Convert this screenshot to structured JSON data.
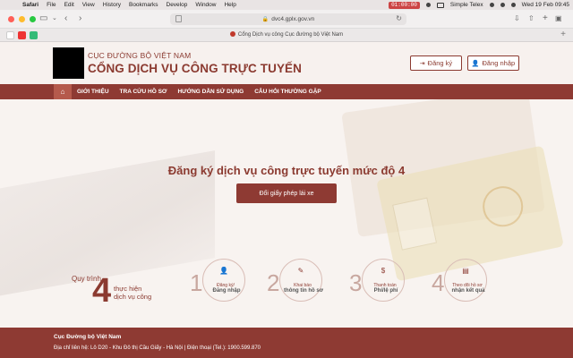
{
  "menubar": {
    "app": "Safari",
    "items": [
      "File",
      "Edit",
      "View",
      "History",
      "Bookmarks",
      "Develop",
      "Window",
      "Help"
    ],
    "timer": "01:00:00",
    "input_method": "Simple Telex",
    "datetime": "Wed 19 Feb  09:45"
  },
  "browser": {
    "url": "dvc4.gplx.gov.vn",
    "tab_title": "Cổng Dịch vụ công Cục đường bộ Việt Nam"
  },
  "header": {
    "org_name": "CỤC ĐƯỜNG BỘ VIỆT NAM",
    "portal_name": "CỔNG DỊCH VỤ CÔNG TRỰC TUYẾN",
    "register": "Đăng ký",
    "login": "Đăng nhập"
  },
  "nav": {
    "items": [
      "GIỚI THIỆU",
      "TRA CỨU HỒ SƠ",
      "HƯỚNG DẪN SỬ DỤNG",
      "CÂU HỎI THƯỜNG GẶP"
    ]
  },
  "hero": {
    "title": "Đăng ký dịch vụ công trực tuyến mức độ 4",
    "button": "Đổi giấy phép lái xe"
  },
  "process": {
    "label": "Quy trình",
    "number": "4",
    "sub1": "thực hiện",
    "sub2": "dịch vụ công",
    "steps": [
      {
        "num": "1",
        "line1": "Đăng ký/",
        "line2": "Đăng nhập",
        "icon": "user-icon"
      },
      {
        "num": "2",
        "line1": "Khai báo",
        "line2": "thông tin hồ sơ",
        "icon": "edit-icon"
      },
      {
        "num": "3",
        "line1": "Thanh toán",
        "line2": "Phí/lệ phí",
        "icon": "payment-icon"
      },
      {
        "num": "4",
        "line1": "Theo dõi hồ sơ",
        "line2": "nhận kết quả",
        "icon": "clipboard-icon"
      }
    ]
  },
  "footer": {
    "org": "Cục Đường bộ Việt Nam",
    "contact": "Địa chỉ liên hệ: Lô D20 - Khu Đô thị Cầu Giấy - Hà Nội | Điện thoại (Tel.): 1900.599.870"
  }
}
